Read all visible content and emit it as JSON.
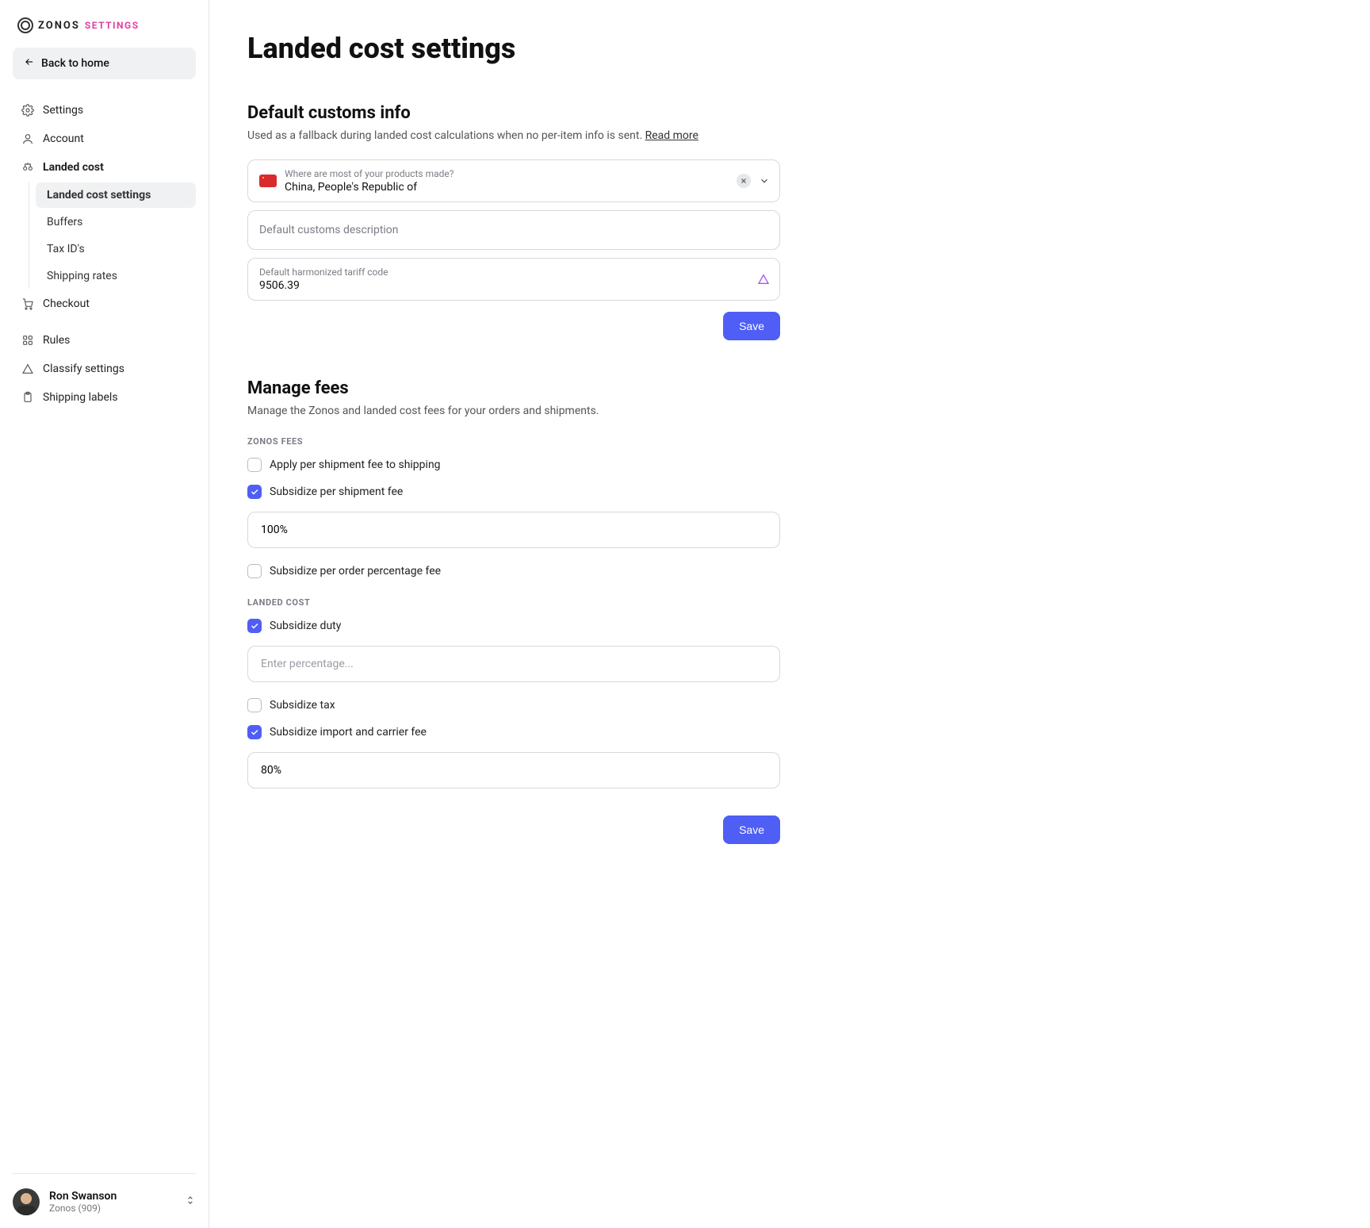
{
  "brand": {
    "name": "ZONOS",
    "sub": "SETTINGS"
  },
  "back_label": "Back to home",
  "nav": {
    "settings": "Settings",
    "account": "Account",
    "landed_cost": "Landed cost",
    "landed_sub": {
      "settings": "Landed cost settings",
      "buffers": "Buffers",
      "tax_ids": "Tax ID's",
      "shipping_rates": "Shipping rates"
    },
    "checkout": "Checkout",
    "rules": "Rules",
    "classify": "Classify settings",
    "shipping_labels": "Shipping labels"
  },
  "user": {
    "name": "Ron Swanson",
    "org": "Zonos (909)"
  },
  "page": {
    "title": "Landed cost settings"
  },
  "customs": {
    "title": "Default customs info",
    "desc": "Used as a fallback during landed cost calculations when no per-item info is sent. ",
    "read_more": "Read more",
    "origin_label": "Where are most of your products made?",
    "origin_value": "China, People's Republic of",
    "desc_placeholder": "Default customs description",
    "tariff_label": "Default harmonized tariff code",
    "tariff_value": "9506.39",
    "save": "Save"
  },
  "fees": {
    "title": "Manage fees",
    "desc": "Manage the Zonos and landed cost fees for your orders and shipments.",
    "zonos_heading": "ZONOS FEES",
    "apply_shipment": "Apply per shipment fee to shipping",
    "sub_shipment": "Subsidize per shipment fee",
    "sub_shipment_val": "100%",
    "sub_order_pct": "Subsidize per order percentage fee",
    "landed_heading": "LANDED COST",
    "sub_duty": "Subsidize duty",
    "sub_duty_placeholder": "Enter percentage...",
    "sub_tax": "Subsidize tax",
    "sub_import": "Subsidize import and carrier fee",
    "sub_import_val": "80%",
    "save": "Save"
  }
}
